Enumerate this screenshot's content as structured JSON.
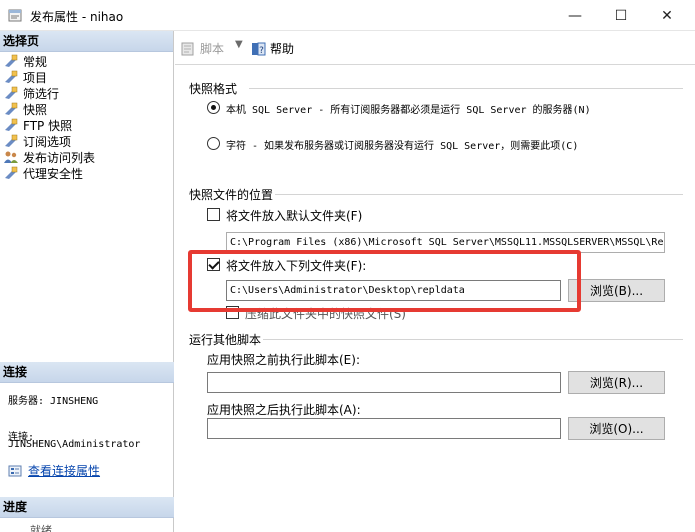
{
  "window": {
    "title": "发布属性 - nihao",
    "minimize": "—",
    "maximize": "☐",
    "close": "✕"
  },
  "left": {
    "select_page_header": "选择页",
    "nav_items": [
      {
        "label": "常规",
        "icon": "page-icon"
      },
      {
        "label": "项目",
        "icon": "page-icon"
      },
      {
        "label": "筛选行",
        "icon": "page-icon"
      },
      {
        "label": "快照",
        "icon": "page-icon"
      },
      {
        "label": "FTP 快照",
        "icon": "page-icon"
      },
      {
        "label": "订阅选项",
        "icon": "page-icon"
      },
      {
        "label": "发布访问列表",
        "icon": "users-icon"
      },
      {
        "label": "代理安全性",
        "icon": "page-icon"
      }
    ],
    "connection_header": "连接",
    "server_line": "服务器: JINSHENG",
    "connection_label": "连接:",
    "connection_value": "JINSHENG\\Administrator",
    "view_connection_props": "查看连接属性",
    "progress_header": "进度",
    "progress_status": "就绪"
  },
  "toolbar": {
    "script_label": "脚本",
    "dropdown": "▼",
    "help_label": "帮助"
  },
  "main": {
    "snapshot_format_title": "快照格式",
    "radio_native_label": "本机 SQL Server - 所有订阅服务器都必须是运行 SQL Server 的服务器(N)",
    "radio_char_label": "字符 - 如果发布服务器或订阅服务器没有运行 SQL Server，则需要此项(C)",
    "location_title": "快照文件的位置",
    "default_folder_label": "将文件放入默认文件夹(F)",
    "default_folder_path": "C:\\Program Files (x86)\\Microsoft SQL Server\\MSSQL11.MSSQLSERVER\\MSSQL\\Re",
    "put_folder_label": "将文件放入下列文件夹(F):",
    "put_folder_path": "C:\\Users\\Administrator\\Desktop\\repldata",
    "browse1": "浏览(B)...",
    "compress_label": "压缩此文件夹中的快照文件(S)",
    "other_scripts_title": "运行其他脚本",
    "before_label": "应用快照之前执行此脚本(E):",
    "before_value": "",
    "browse2": "浏览(R)...",
    "after_label": "应用快照之后执行此脚本(A):",
    "after_value": "",
    "browse3": "浏览(O)..."
  },
  "colors": {
    "highlight": "#e63a32",
    "header_bg": "#c7d6ea",
    "link": "#0645ad"
  }
}
